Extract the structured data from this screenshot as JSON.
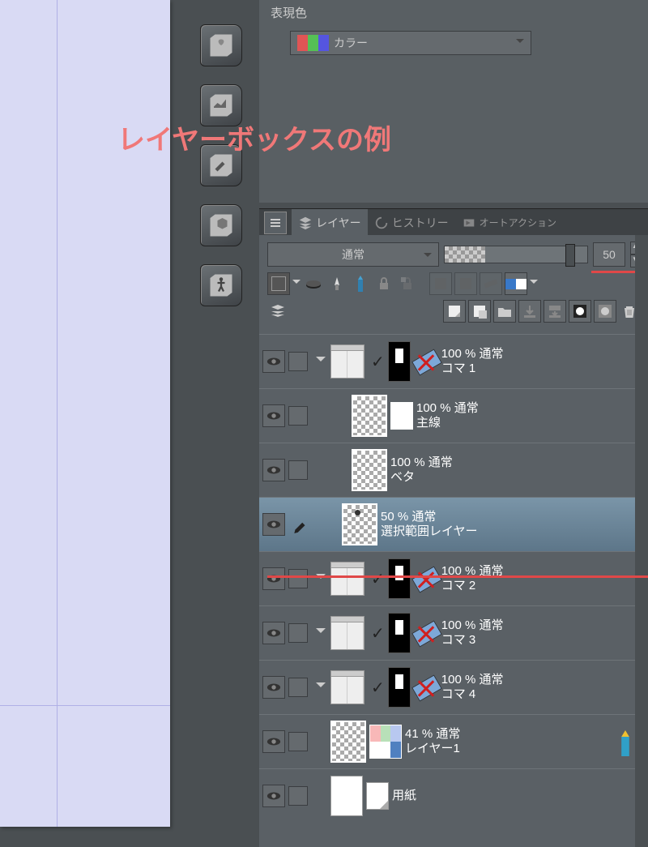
{
  "annotation": "レイヤーボックスの例",
  "property_panel": {
    "title": "表現色",
    "color_mode": "カラー"
  },
  "tabs": {
    "layer": "レイヤー",
    "history": "ヒストリー",
    "autoaction": "オートアクション"
  },
  "blend": {
    "mode": "通常",
    "opacity": "50"
  },
  "layers": [
    {
      "id": "koma1",
      "info": "100 % 通常",
      "name": "コマ 1",
      "type": "folder",
      "mask": true,
      "ruler": true,
      "ruler_disabled": true,
      "expand": true,
      "indent": 0
    },
    {
      "id": "shusen",
      "info": "100 % 通常",
      "name": "主線",
      "type": "raster",
      "small_over": true,
      "indent": 1
    },
    {
      "id": "beta",
      "info": "100 % 通常",
      "name": "ベタ",
      "type": "raster",
      "indent": 1
    },
    {
      "id": "sel",
      "info": "50 % 通常",
      "name": "選択範囲レイヤー",
      "type": "raster",
      "selected": true,
      "brush_marker": true,
      "indent": 1
    },
    {
      "id": "koma2",
      "info": "100 % 通常",
      "name": "コマ 2",
      "type": "folder",
      "mask": true,
      "ruler": true,
      "ruler_disabled": true,
      "expand": true,
      "indent": 0
    },
    {
      "id": "koma3",
      "info": "100 % 通常",
      "name": "コマ 3",
      "type": "folder",
      "mask": true,
      "ruler": true,
      "ruler_disabled": true,
      "expand": true,
      "indent": 0
    },
    {
      "id": "koma4",
      "info": "100 % 通常",
      "name": "コマ 4",
      "type": "folder",
      "mask": true,
      "ruler": true,
      "ruler_disabled": true,
      "expand": true,
      "indent": 0
    },
    {
      "id": "layer1",
      "info": "41 % 通常",
      "name": "レイヤー1",
      "type": "color",
      "pencil": true,
      "indent": 0
    },
    {
      "id": "paper",
      "info": "",
      "name": "用紙",
      "type": "paper",
      "indent": 0
    }
  ]
}
